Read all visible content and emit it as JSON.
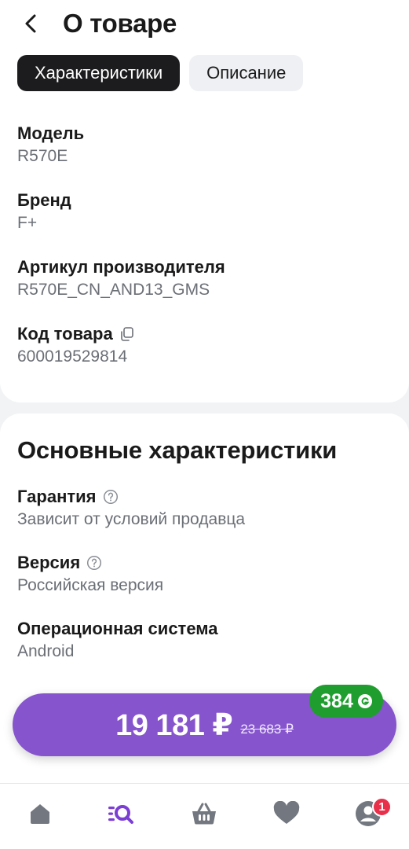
{
  "header": {
    "title": "О товаре"
  },
  "tabs": [
    {
      "label": "Характеристики",
      "active": true
    },
    {
      "label": "Описание",
      "active": false
    }
  ],
  "product_specs": [
    {
      "label": "Модель",
      "value": "R570E"
    },
    {
      "label": "Бренд",
      "value": "F+"
    },
    {
      "label": "Артикул производителя",
      "value": "R570E_CN_AND13_GMS"
    },
    {
      "label": "Код товара",
      "value": "600019529814"
    }
  ],
  "main_specs": {
    "title": "Основные характеристики",
    "items": [
      {
        "label": "Гарантия",
        "value": "Зависит от условий продавца"
      },
      {
        "label": "Версия",
        "value": "Российская версия"
      },
      {
        "label": "Операционная система",
        "value": "Android"
      }
    ]
  },
  "buy": {
    "price": "19 181 ₽",
    "old_price": "23 683 ₽",
    "bonus": "384"
  },
  "bottom_nav": {
    "items": [
      {
        "name": "home-icon"
      },
      {
        "name": "catalog-search-icon"
      },
      {
        "name": "cart-icon"
      },
      {
        "name": "favorites-heart-icon"
      },
      {
        "name": "profile-icon"
      }
    ],
    "profile_badge": "1"
  },
  "colors": {
    "accent_purple": "#8654cc",
    "bonus_green": "#1f9e2f",
    "catalog_purple": "#7b3fd4",
    "badge_red": "#e8304a"
  }
}
